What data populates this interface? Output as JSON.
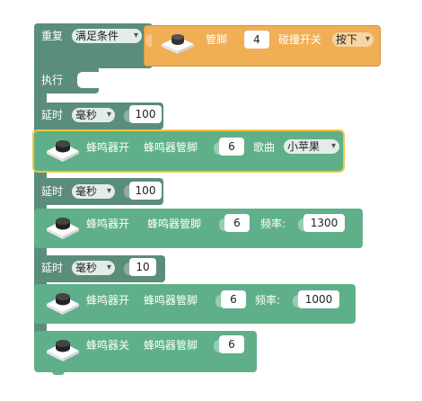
{
  "repeat_block": {
    "label": "重复",
    "condition": "满足条件",
    "do_label": "执行"
  },
  "button_condition": {
    "pin_label": "管脚",
    "pin_value": "4",
    "switch_label": "碰撞开关",
    "state": "按下"
  },
  "delays": [
    {
      "label": "延时",
      "unit": "毫秒",
      "value": "100"
    },
    {
      "label": "延时",
      "unit": "毫秒",
      "value": "100"
    },
    {
      "label": "延时",
      "unit": "毫秒",
      "value": "10"
    }
  ],
  "buzzer_song": {
    "label": "蜂鸣器开",
    "pin_label": "蜂鸣器管脚",
    "pin_value": "6",
    "song_label": "歌曲",
    "song": "小苹果"
  },
  "buzzer_freq_1": {
    "label": "蜂鸣器开",
    "pin_label": "蜂鸣器管脚",
    "pin_value": "6",
    "freq_label": "频率:",
    "freq_value": "1300"
  },
  "buzzer_freq_2": {
    "label": "蜂鸣器开",
    "pin_label": "蜂鸣器管脚",
    "pin_value": "6",
    "freq_label": "频率:",
    "freq_value": "1000"
  },
  "buzzer_off": {
    "label": "蜂鸣器关",
    "pin_label": "蜂鸣器管脚",
    "pin_value": "6"
  },
  "icons": {
    "buzzer": "buzzer-icon",
    "button": "push-button-icon"
  },
  "colors": {
    "control": "#5b8e7a",
    "actuator": "#5fb08a",
    "sensor": "#f0ae55",
    "selected_outline": "#f3c63c"
  }
}
